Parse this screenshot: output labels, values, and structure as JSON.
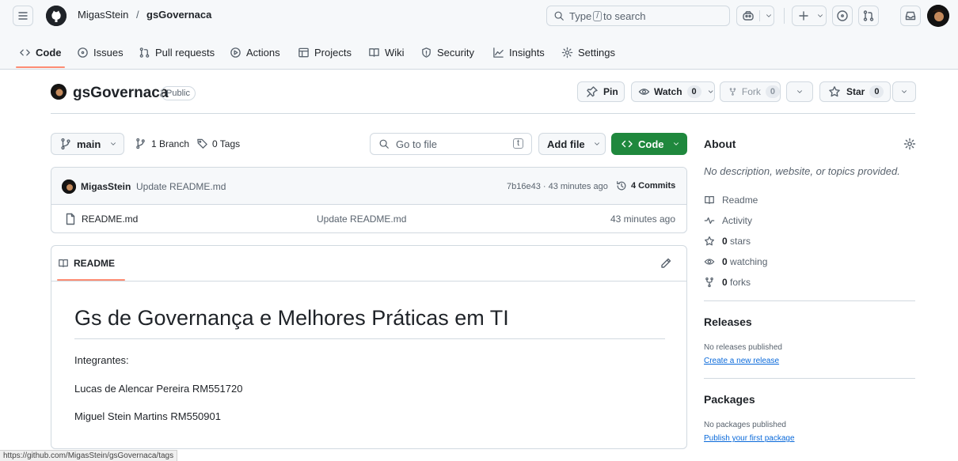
{
  "header": {
    "owner": "MigasStein",
    "separator": "/",
    "repo": "gsGovernaca",
    "search_prefix": "Type",
    "search_key": "/",
    "search_suffix": "to search"
  },
  "nav": {
    "tabs": [
      {
        "label": "Code",
        "icon": "code-icon"
      },
      {
        "label": "Issues",
        "icon": "issue-icon"
      },
      {
        "label": "Pull requests",
        "icon": "pull-request-icon"
      },
      {
        "label": "Actions",
        "icon": "play-icon"
      },
      {
        "label": "Projects",
        "icon": "table-icon"
      },
      {
        "label": "Wiki",
        "icon": "book-icon"
      },
      {
        "label": "Security",
        "icon": "shield-icon"
      },
      {
        "label": "Insights",
        "icon": "graph-icon"
      },
      {
        "label": "Settings",
        "icon": "gear-icon"
      }
    ]
  },
  "repo": {
    "name": "gsGovernaca",
    "visibility": "Public",
    "pin_label": "Pin",
    "watch_label": "Watch",
    "watch_count": "0",
    "fork_label": "Fork",
    "fork_count": "0",
    "star_label": "Star",
    "star_count": "0"
  },
  "toolbar": {
    "branch": "main",
    "branch_count": "1 Branch",
    "tag_count": "0 Tags",
    "go_to_file": "Go to file",
    "go_to_file_key": "t",
    "add_file": "Add file",
    "code_button": "Code"
  },
  "latest_commit": {
    "author": "MigasStein",
    "message": "Update README.md",
    "meta": "7b16e43 · 43 minutes ago",
    "commits": "4 Commits"
  },
  "files": [
    {
      "name": "README.md",
      "message": "Update README.md",
      "age": "43 minutes ago"
    }
  ],
  "readme": {
    "tab_label": "README",
    "heading": "Gs de Governança e Melhores Práticas em TI",
    "paragraphs": [
      "Integrantes:",
      "Lucas de Alencar Pereira RM551720",
      "Miguel Stein Martins RM550901"
    ]
  },
  "sidebar": {
    "about_title": "About",
    "about_description": "No description, website, or topics provided.",
    "readme_link": "Readme",
    "activity_link": "Activity",
    "stars_count": "0",
    "stars_label": "stars",
    "watching_count": "0",
    "watching_label": "watching",
    "forks_count": "0",
    "forks_label": "forks",
    "releases_title": "Releases",
    "releases_empty": "No releases published",
    "releases_link": "Create a new release",
    "packages_title": "Packages",
    "packages_empty": "No packages published",
    "packages_link": "Publish your first package"
  },
  "status_url": "https://github.com/MigasStein/gsGovernaca/tags",
  "colors": {
    "accent_underline": "#fd8c73",
    "code_button": "#1f883d",
    "link": "#0969da"
  }
}
